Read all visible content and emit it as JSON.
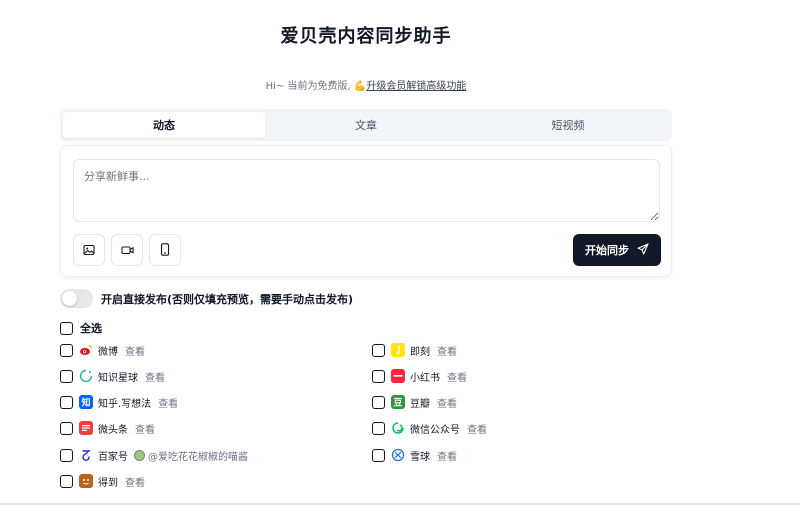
{
  "header": {
    "title": "爱贝壳内容同步助手",
    "notice_prefix": "Hi~ 当前为免费版,",
    "notice_emoji": "💪",
    "notice_link": "升级会员解锁高级功能"
  },
  "tabs": [
    {
      "label": "动态",
      "active": true
    },
    {
      "label": "文章",
      "active": false
    },
    {
      "label": "短视频",
      "active": false
    }
  ],
  "composer": {
    "placeholder": "分享新鲜事...",
    "tools": [
      "image-icon",
      "video-icon",
      "phone-icon"
    ],
    "sync_label": "开始同步",
    "sync_icon": "send-icon"
  },
  "toggle": {
    "label": "开启直接发布(否则仅填充预览，需要手动点击发布)",
    "on": false
  },
  "select_all": {
    "label": "全选"
  },
  "platforms": {
    "left": [
      {
        "name": "微博",
        "view": "查看",
        "icon": "weibo-icon",
        "color": "#e6162d"
      },
      {
        "name": "知识星球",
        "view": "查看",
        "icon": "zsxq-icon",
        "color": "#16b998"
      },
      {
        "name": "知乎.写想法",
        "view": "查看",
        "icon": "zhihu-icon",
        "color": "#0066ff"
      },
      {
        "name": "微头条",
        "view": "查看",
        "icon": "toutiao-icon",
        "color": "#f04142"
      },
      {
        "name": "百家号",
        "view": "",
        "account": "@爱吃花花椒椒的喵酱",
        "icon": "baijiahao-icon",
        "color": "#2932e1"
      },
      {
        "name": "得到",
        "view": "查看",
        "icon": "dedao-icon",
        "color": "#b8631a"
      }
    ],
    "right": [
      {
        "name": "即刻",
        "view": "查看",
        "icon": "jike-icon",
        "color": "#ffe411"
      },
      {
        "name": "小红书",
        "view": "查看",
        "icon": "xiaohongshu-icon",
        "color": "#ff2442"
      },
      {
        "name": "豆瓣",
        "view": "查看",
        "icon": "douban-icon",
        "color": "#2e963d"
      },
      {
        "name": "微信公众号",
        "view": "查看",
        "icon": "wechat-icon",
        "color": "#07c160"
      },
      {
        "name": "雪球",
        "view": "查看",
        "icon": "xueqiu-icon",
        "color": "#1f6fd6"
      }
    ]
  }
}
